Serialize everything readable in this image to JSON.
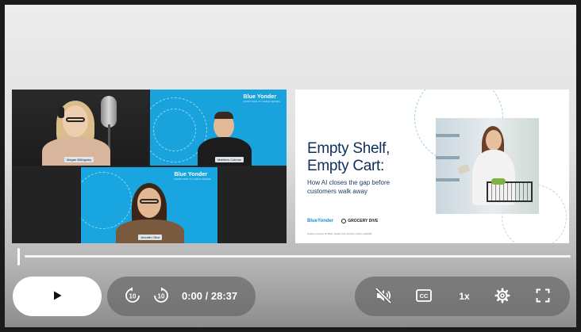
{
  "video": {
    "participants": [
      "Megan Billingsley",
      "Matthew Colman",
      "Jennifer Olive"
    ],
    "brand_badge": "Blue Yonder",
    "brand_badge_sub": "FROM TAPE TO TABLE SERIES",
    "slide": {
      "title": "Empty Shelf,\nEmpty Cart:",
      "subtitle": "How AI closes the gap before customers walk away",
      "logo_1": "BlueYonder",
      "logo_2": "GROCERY DIVE",
      "footnote": "Custom content for Blue Yonder from Grocery Dive's studioID"
    }
  },
  "player": {
    "progress": 0.0,
    "time_display": "0:00 / 28:37",
    "speed_label": "1x",
    "colors": {
      "accent": "#ffffff",
      "call_bg": "#18a3dd",
      "slide_title": "#0e2f5c"
    }
  },
  "icons": {
    "play": "play-icon",
    "rewind": "rewind-10-icon",
    "forward": "forward-10-icon",
    "mute": "volume-muted-icon",
    "captions": "closed-captions-icon",
    "settings": "gear-icon",
    "fullscreen": "fullscreen-icon"
  }
}
